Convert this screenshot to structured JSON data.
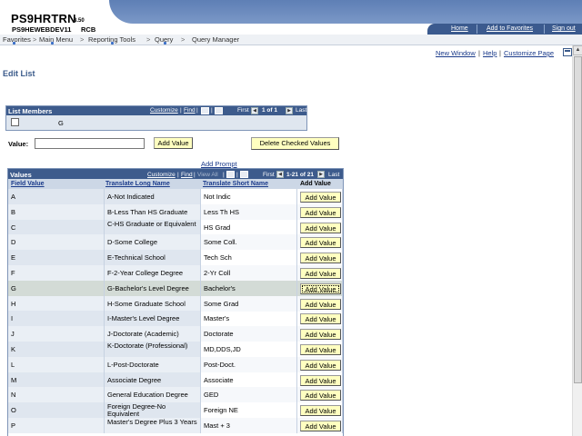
{
  "header": {
    "title": "PS9HRTRN",
    "version": "8.50",
    "database": "PS9HEWEBDEV11",
    "user": "RCB",
    "links": {
      "home": "Home",
      "favorites": "Add to Favorites",
      "signout": "Sign out"
    }
  },
  "menubar": {
    "items": [
      "Favorites",
      "Main Menu",
      "Reporting Tools",
      "Query",
      "Query Manager"
    ],
    "sep": ">"
  },
  "pagelinks": {
    "new_window": "New Window",
    "help": "Help",
    "customize": "Customize Page",
    "sep": "|"
  },
  "page_title": "Edit List",
  "list_members": {
    "title": "List Members",
    "customize": "Customize",
    "find": "Find",
    "first": "First",
    "range": "1 of 1",
    "last": "Last",
    "sep": "|",
    "row_value": "G"
  },
  "value_form": {
    "label": "Value:",
    "input_value": "",
    "add_button": "Add Value",
    "delete_button": "Delete Checked Values",
    "add_prompt": "Add Prompt"
  },
  "values_grid": {
    "title": "Values",
    "customize": "Customize",
    "find": "Find",
    "view_all": "View All",
    "first": "First",
    "range": "1-21 of 21",
    "last": "Last",
    "sep": "|",
    "columns": [
      "Field Value",
      "Translate Long Name",
      "Translate Short Name",
      "Add Value"
    ],
    "button_label": "Add Value",
    "rows": [
      [
        "A",
        "A-Not Indicated",
        "Not Indic"
      ],
      [
        "B",
        "B-Less Than HS Graduate",
        "Less Th HS"
      ],
      [
        "C",
        "C-HS Graduate or Equivalent",
        "HS Grad"
      ],
      [
        "D",
        "D-Some College",
        "Some Coll."
      ],
      [
        "E",
        "E-Technical School",
        "Tech Sch"
      ],
      [
        "F",
        "F-2-Year College Degree",
        "2-Yr Coll"
      ],
      [
        "G",
        "G-Bachelor's Level Degree",
        "Bachelor's"
      ],
      [
        "H",
        "H-Some Graduate School",
        "Some Grad"
      ],
      [
        "I",
        "I-Master's Level Degree",
        "Master's"
      ],
      [
        "J",
        "J-Doctorate (Academic)",
        "Doctorate"
      ],
      [
        "K",
        "K-Doctorate (Professional)",
        "MD,DDS,JD"
      ],
      [
        "L",
        "L-Post-Doctorate",
        "Post-Doct."
      ],
      [
        "M",
        "Associate Degree",
        "Associate"
      ],
      [
        "N",
        "General Education Degree",
        "GED"
      ],
      [
        "O",
        "Foreign Degree-No Equivalent",
        "Foreign NE"
      ],
      [
        "P",
        "Master's Degree Plus 3 Years",
        "Mast + 3"
      ]
    ]
  },
  "scroll": {
    "up": "▲"
  }
}
